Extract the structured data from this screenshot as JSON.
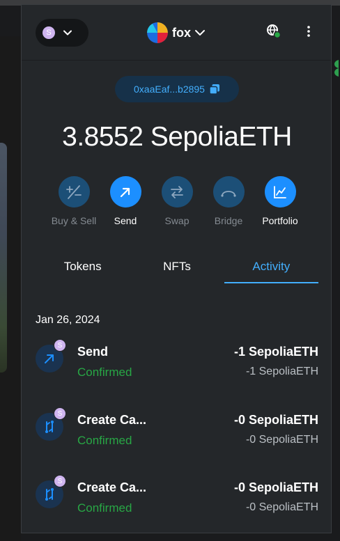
{
  "network": {
    "avatar_letter": "S"
  },
  "account": {
    "name": "fox"
  },
  "address": {
    "short": "0xaaEaf...b2895"
  },
  "balance": {
    "text": "3.8552 SepoliaETH"
  },
  "actions": [
    {
      "label": "Buy & Sell",
      "icon": "plus-minus-icon",
      "enabled": false
    },
    {
      "label": "Send",
      "icon": "arrow-up-right-icon",
      "enabled": true
    },
    {
      "label": "Swap",
      "icon": "swap-icon",
      "enabled": false
    },
    {
      "label": "Bridge",
      "icon": "bridge-icon",
      "enabled": false
    },
    {
      "label": "Portfolio",
      "icon": "chart-icon",
      "enabled": true
    }
  ],
  "tabs": [
    {
      "label": "Tokens",
      "active": false
    },
    {
      "label": "NFTs",
      "active": false
    },
    {
      "label": "Activity",
      "active": true
    }
  ],
  "activity": {
    "date": "Jan 26, 2024",
    "items": [
      {
        "title": "Send",
        "status": "Confirmed",
        "amount": "-1 SepoliaETH",
        "fiat": "-1 SepoliaETH",
        "badge": "S",
        "icon": "send-arrow-icon"
      },
      {
        "title": "Create Ca...",
        "status": "Confirmed",
        "amount": "-0 SepoliaETH",
        "fiat": "-0 SepoliaETH",
        "badge": "S",
        "icon": "contract-interaction-icon"
      },
      {
        "title": "Create Ca...",
        "status": "Confirmed",
        "amount": "-0 SepoliaETH",
        "fiat": "-0 SepoliaETH",
        "badge": "S",
        "icon": "contract-interaction-icon"
      }
    ]
  },
  "colors": {
    "accent": "#43aefc",
    "primary": "#1c8fff",
    "success": "#28a745",
    "background": "#24272a"
  }
}
